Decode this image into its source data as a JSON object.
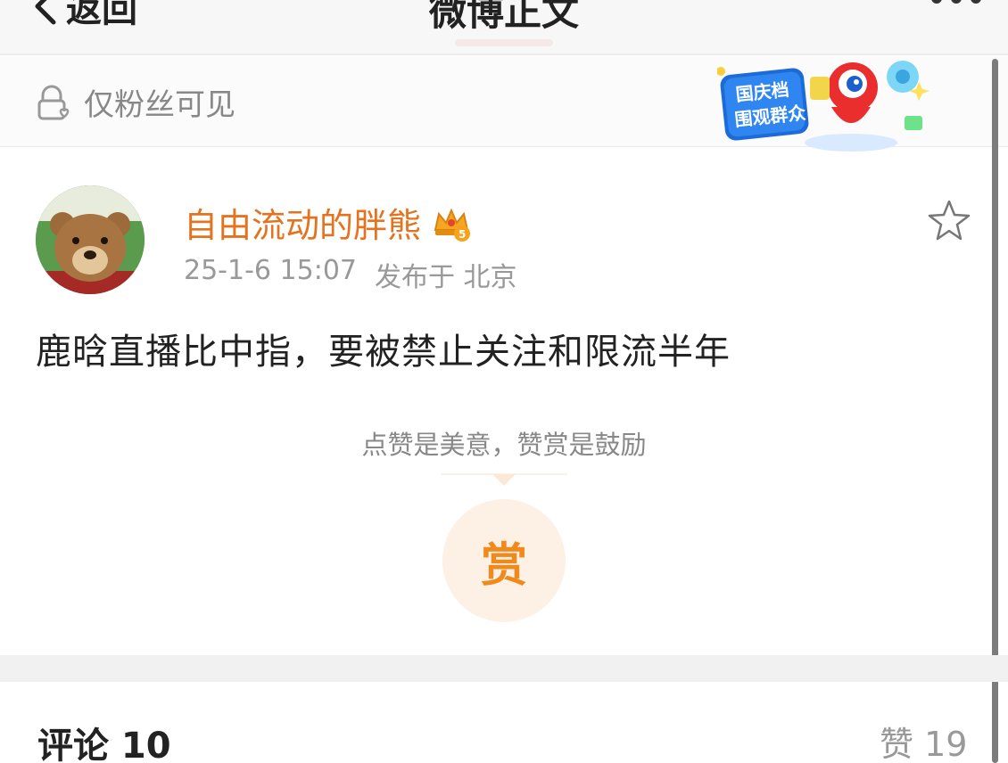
{
  "nav": {
    "back_label": "返回",
    "title": "微博正文"
  },
  "visibility": {
    "label": "仅粉丝可见"
  },
  "promo": {
    "line1": "国庆档",
    "line2": "围观群众"
  },
  "post": {
    "username": "自由流动的胖熊",
    "badge_level": "5",
    "timestamp": "25-1-6 15:07",
    "published_at": "发布于 北京",
    "text": "鹿晗直播比中指，要被禁止关注和限流半年"
  },
  "reward": {
    "hint": "点赞是美意，赞赏是鼓励",
    "button_label": "赏"
  },
  "footer": {
    "comments_label": "评论 10",
    "likes_label": "赞 19"
  },
  "colors": {
    "username": "#e5721e",
    "reward_accent": "#f08a1c",
    "muted_text": "#999999"
  }
}
